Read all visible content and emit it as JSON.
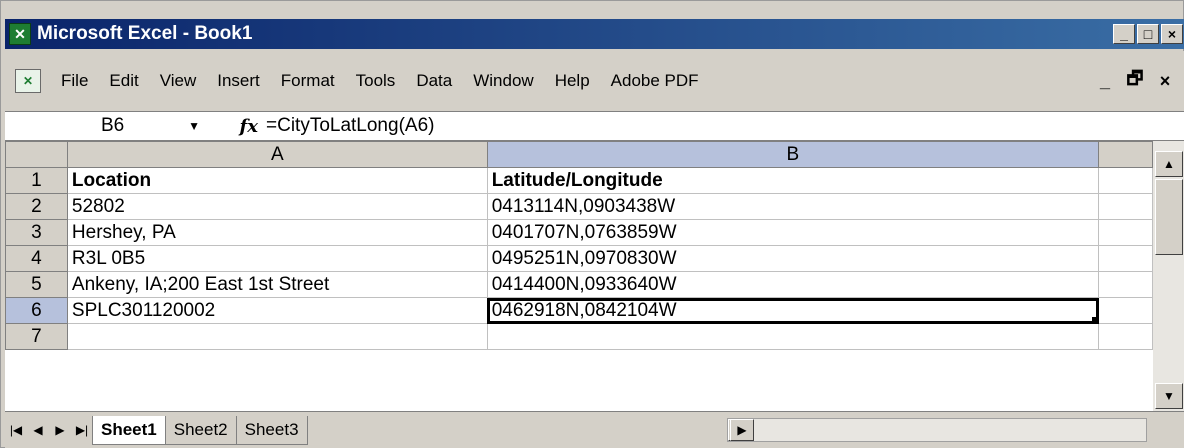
{
  "window": {
    "title": "Microsoft Excel - Book1",
    "controls": [
      "_",
      "□",
      "×"
    ]
  },
  "menu": {
    "items": [
      "File",
      "Edit",
      "View",
      "Insert",
      "Format",
      "Tools",
      "Data",
      "Window",
      "Help",
      "Adobe PDF"
    ],
    "mdi_controls": [
      "_",
      "🗗",
      "×"
    ]
  },
  "formula_bar": {
    "name_box": "B6",
    "fx": "fx",
    "formula": "=CityToLatLong(A6)"
  },
  "sheet": {
    "columns": [
      "A",
      "B"
    ],
    "rows": [
      {
        "num": "1",
        "a": "Location",
        "b": "Latitude/Longitude"
      },
      {
        "num": "2",
        "a": "52802",
        "b": "0413114N,0903438W"
      },
      {
        "num": "3",
        "a": "Hershey, PA",
        "b": "0401707N,0763859W"
      },
      {
        "num": "4",
        "a": "R3L 0B5",
        "b": "0495251N,0970830W"
      },
      {
        "num": "5",
        "a": "Ankeny, IA;200 East 1st Street",
        "b": "0414400N,0933640W"
      },
      {
        "num": "6",
        "a": "SPLC301120002",
        "b": "0462918N,0842104W"
      },
      {
        "num": "7",
        "a": "",
        "b": ""
      }
    ]
  },
  "tabs": [
    "Sheet1",
    "Sheet2",
    "Sheet3"
  ],
  "active_tab": "Sheet1",
  "colors": {
    "title_bar": "#0a246a",
    "selection_header": "#b6c1dc",
    "chrome": "#d4d0c8"
  }
}
